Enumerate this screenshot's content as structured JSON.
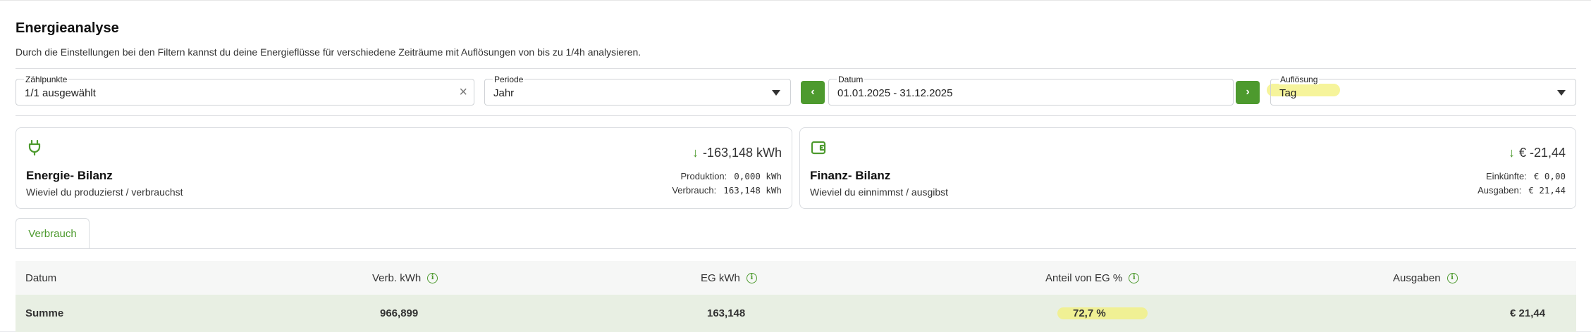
{
  "header": {
    "title": "Energieanalyse",
    "subtitle": "Durch die Einstellungen bei den Filtern kannst du deine Energieflüsse für verschiedene Zeiträume mit Auflösungen von bis zu 1/4h analysieren."
  },
  "filters": {
    "zaehlpunkte": {
      "label": "Zählpunkte",
      "value": "1/1 ausgewählt",
      "clear": "×"
    },
    "periode": {
      "label": "Periode",
      "value": "Jahr"
    },
    "datum": {
      "label": "Datum",
      "value": "01.01.2025 - 31.12.2025",
      "prev": "‹",
      "next": "›"
    },
    "aufloesung": {
      "label": "Auflösung",
      "value": "Tag"
    }
  },
  "cards": {
    "energie": {
      "icon": "plug-icon",
      "title": "Energie- Bilanz",
      "subtitle": "Wieviel du produzierst / verbrauchst",
      "total": "-163,148 kWh",
      "rows": [
        {
          "key": "Produktion:",
          "value": "0,000 kWh"
        },
        {
          "key": "Verbrauch:",
          "value": "163,148 kWh"
        }
      ]
    },
    "finanz": {
      "icon": "wallet-icon",
      "title": "Finanz- Bilanz",
      "subtitle": "Wieviel du einnimmst / ausgibst",
      "total": "€ -21,44",
      "rows": [
        {
          "key": "Einkünfte:",
          "value": "€ 0,00"
        },
        {
          "key": "Ausgaben:",
          "value": "€ 21,44"
        }
      ]
    }
  },
  "tabs": [
    {
      "label": "Verbrauch",
      "active": true
    }
  ],
  "table": {
    "columns": [
      "Datum",
      "Verb. kWh",
      "EG kWh",
      "Anteil von EG %",
      "Ausgaben"
    ],
    "summary": [
      "Summe",
      "966,899",
      "163,148",
      "72,7 %",
      "€ 21,44"
    ]
  },
  "colors": {
    "accent": "#4d9a2e",
    "highlight": "#f3f07a",
    "summary_row": "#e8efe3",
    "header_row": "#f6f7f6"
  }
}
